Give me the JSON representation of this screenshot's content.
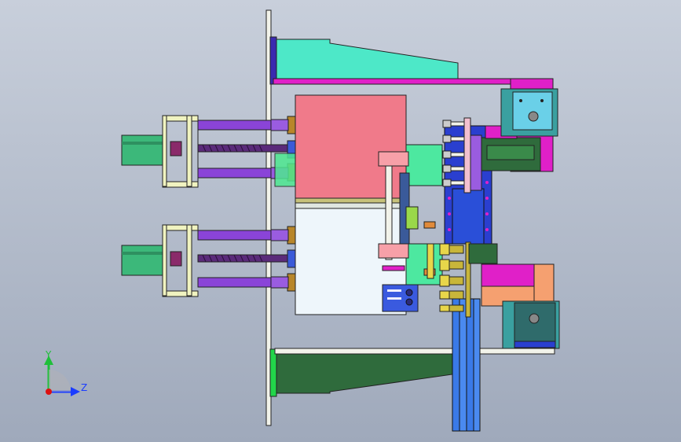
{
  "viewport": {
    "background_top": "#c8cfdb",
    "background_bottom": "#9fa9bb"
  },
  "triad": {
    "y_label": "Y",
    "z_label": "Z",
    "y_color": "#1fbf3a",
    "z_color": "#1a3cff",
    "origin_color": "#d11"
  },
  "colors": {
    "plate": "#f2f3ea",
    "rod": "#8a44d8",
    "screw": "#5a2a7a",
    "motor": "#3cb87a",
    "block_pink": "#f07a8a",
    "block_white": "#eef6fb",
    "cyan": "#4de8c8",
    "magenta": "#e020c8",
    "green_dark": "#2f6b3c",
    "teal": "#3aa0a0",
    "blue": "#2a3fcf",
    "yellow": "#e8d64a",
    "orange": "#e08a3a",
    "salmon": "#f5a070"
  }
}
